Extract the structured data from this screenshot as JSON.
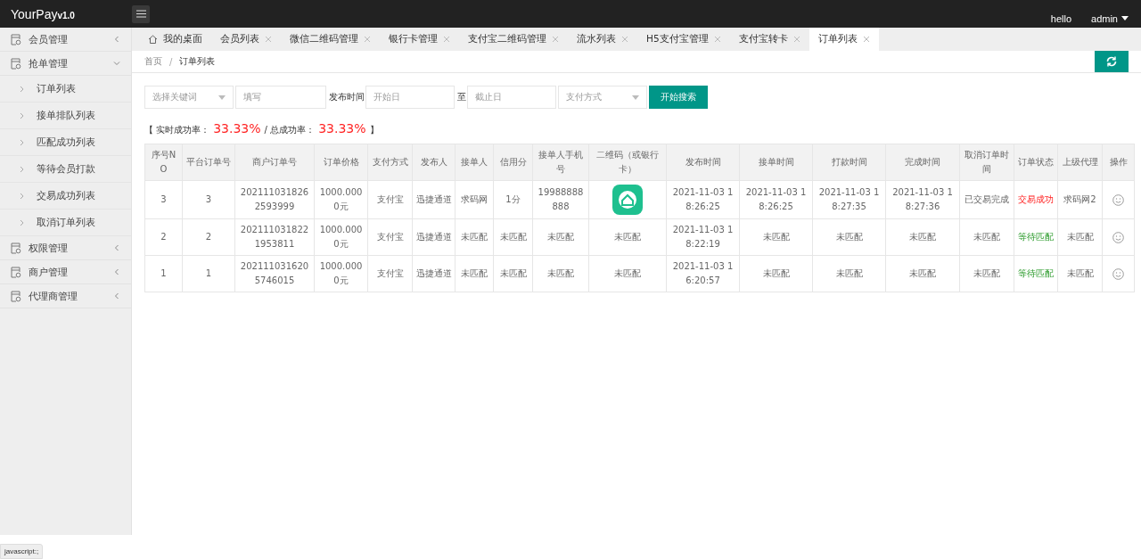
{
  "header": {
    "logo": "YourPay",
    "version": "v1.0",
    "links": [
      "hello"
    ],
    "user": "admin"
  },
  "sidebar": {
    "items": [
      {
        "label": "会员管理",
        "expanded": false
      },
      {
        "label": "抢单管理",
        "expanded": true,
        "children": [
          {
            "label": "订单列表"
          },
          {
            "label": "接单排队列表"
          },
          {
            "label": "匹配成功列表"
          },
          {
            "label": "等待会员打款"
          },
          {
            "label": "交易成功列表"
          },
          {
            "label": "取消订单列表"
          }
        ]
      },
      {
        "label": "权限管理",
        "expanded": false
      },
      {
        "label": "商户管理",
        "expanded": false
      },
      {
        "label": "代理商管理",
        "expanded": false
      }
    ]
  },
  "tabs": [
    {
      "label": "我的桌面",
      "kind": "home",
      "selected": false
    },
    {
      "label": "会员列表",
      "kind": "closable",
      "selected": false
    },
    {
      "label": "微信二维码管理",
      "kind": "closable",
      "selected": false
    },
    {
      "label": "银行卡管理",
      "kind": "closable",
      "selected": false
    },
    {
      "label": "支付宝二维码管理",
      "kind": "closable",
      "selected": false
    },
    {
      "label": "流水列表",
      "kind": "closable",
      "selected": false
    },
    {
      "label": "H5支付宝管理",
      "kind": "closable",
      "selected": false
    },
    {
      "label": "支付宝转卡",
      "kind": "closable",
      "selected": false
    },
    {
      "label": "订单列表",
      "kind": "closable",
      "selected": true
    }
  ],
  "breadcrumb": {
    "items": [
      "首页",
      "订单列表"
    ],
    "separator": "/"
  },
  "filters": {
    "keyword_select": {
      "placeholder": "选择关键词"
    },
    "keyword_input": {
      "placeholder": "填写"
    },
    "time_label": "发布时间",
    "start": {
      "placeholder": "开始日"
    },
    "range_label": "至",
    "end": {
      "placeholder": "截止日"
    },
    "pay_select": {
      "placeholder": "支付方式"
    },
    "search_button": "开始搜索"
  },
  "rates": {
    "realtime_label": "【 实时成功率：",
    "realtime_value": "33.33%",
    "total_label": "/ 总成功率：",
    "total_value": "33.33%",
    "close": "】"
  },
  "table": {
    "columns": [
      "序号NO",
      "平台订单号",
      "商户订单号",
      "订单价格",
      "支付方式",
      "发布人",
      "接单人",
      "信用分",
      "接单人手机号",
      "二维码（或银行卡）",
      "发布时间",
      "接单时间",
      "打款时间",
      "完成时间",
      "取消订单时间",
      "订单状态",
      "上级代理",
      "操作"
    ],
    "rows": [
      {
        "cells": [
          {
            "kind": "text",
            "text": "3"
          },
          {
            "kind": "text",
            "text": "3"
          },
          {
            "kind": "text",
            "text": "2021110318262593999"
          },
          {
            "kind": "text",
            "text": "1000.0000元"
          },
          {
            "kind": "text",
            "text": "支付宝"
          },
          {
            "kind": "text",
            "text": "迅捷通道"
          },
          {
            "kind": "text",
            "text": "求码网"
          },
          {
            "kind": "text",
            "text": "1分"
          },
          {
            "kind": "text",
            "text": "19988888888"
          },
          {
            "kind": "qr"
          },
          {
            "kind": "text",
            "text": "2021-11-03 18:26:25"
          },
          {
            "kind": "text",
            "text": "2021-11-03 18:26:25"
          },
          {
            "kind": "text",
            "text": "2021-11-03 18:27:35"
          },
          {
            "kind": "text",
            "text": "2021-11-03 18:27:36"
          },
          {
            "kind": "text",
            "text": "已交易完成"
          },
          {
            "kind": "success",
            "text": "交易成功"
          },
          {
            "kind": "text",
            "text": "求码网2"
          },
          {
            "kind": "action"
          }
        ]
      },
      {
        "cells": [
          {
            "kind": "text",
            "text": "2"
          },
          {
            "kind": "text",
            "text": "2"
          },
          {
            "kind": "text",
            "text": "2021110318221953811"
          },
          {
            "kind": "text",
            "text": "1000.0000元"
          },
          {
            "kind": "text",
            "text": "支付宝"
          },
          {
            "kind": "text",
            "text": "迅捷通道"
          },
          {
            "kind": "text",
            "text": "未匹配"
          },
          {
            "kind": "text",
            "text": "未匹配"
          },
          {
            "kind": "text",
            "text": "未匹配"
          },
          {
            "kind": "text",
            "text": "未匹配"
          },
          {
            "kind": "text",
            "text": "2021-11-03 18:22:19"
          },
          {
            "kind": "text",
            "text": "未匹配"
          },
          {
            "kind": "text",
            "text": "未匹配"
          },
          {
            "kind": "text",
            "text": "未匹配"
          },
          {
            "kind": "text",
            "text": "未匹配"
          },
          {
            "kind": "waiting",
            "text": "等待匹配"
          },
          {
            "kind": "text",
            "text": "未匹配"
          },
          {
            "kind": "action"
          }
        ]
      },
      {
        "cells": [
          {
            "kind": "text",
            "text": "1"
          },
          {
            "kind": "text",
            "text": "1"
          },
          {
            "kind": "text",
            "text": "2021110316205746015"
          },
          {
            "kind": "text",
            "text": "1000.0000元"
          },
          {
            "kind": "text",
            "text": "支付宝"
          },
          {
            "kind": "text",
            "text": "迅捷通道"
          },
          {
            "kind": "text",
            "text": "未匹配"
          },
          {
            "kind": "text",
            "text": "未匹配"
          },
          {
            "kind": "text",
            "text": "未匹配"
          },
          {
            "kind": "text",
            "text": "未匹配"
          },
          {
            "kind": "text",
            "text": "2021-11-03 16:20:57"
          },
          {
            "kind": "text",
            "text": "未匹配"
          },
          {
            "kind": "text",
            "text": "未匹配"
          },
          {
            "kind": "text",
            "text": "未匹配"
          },
          {
            "kind": "text",
            "text": "未匹配"
          },
          {
            "kind": "waiting",
            "text": "等待匹配"
          },
          {
            "kind": "text",
            "text": "未匹配"
          },
          {
            "kind": "action"
          }
        ]
      }
    ]
  },
  "status_bar": {
    "text": "javascript:;"
  }
}
